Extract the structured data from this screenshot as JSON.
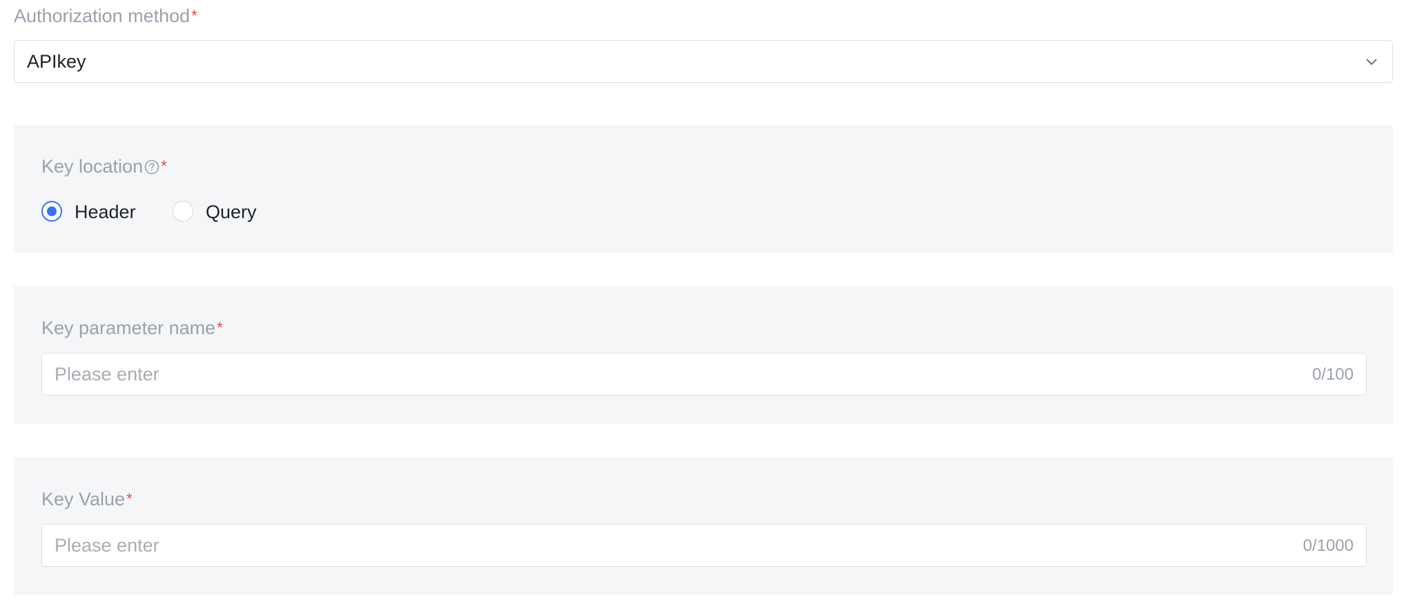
{
  "auth_method": {
    "label": "Authorization method",
    "required_mark": "*",
    "selected_value": "APIkey"
  },
  "key_location": {
    "label": "Key location",
    "required_mark": "*",
    "help_icon": "question-circle-icon",
    "options": [
      {
        "label": "Header",
        "checked": true
      },
      {
        "label": "Query",
        "checked": false
      }
    ]
  },
  "key_param_name": {
    "label": "Key parameter name",
    "required_mark": "*",
    "placeholder": "Please enter",
    "value": "",
    "counter": "0/100"
  },
  "key_value": {
    "label": "Key Value",
    "required_mark": "*",
    "placeholder": "Please enter",
    "value": "",
    "counter": "0/1000"
  },
  "colors": {
    "accent": "#3370ff",
    "required": "#f53f3f",
    "panel_bg": "#f5f6f8",
    "label_text": "#9aa1ad"
  }
}
